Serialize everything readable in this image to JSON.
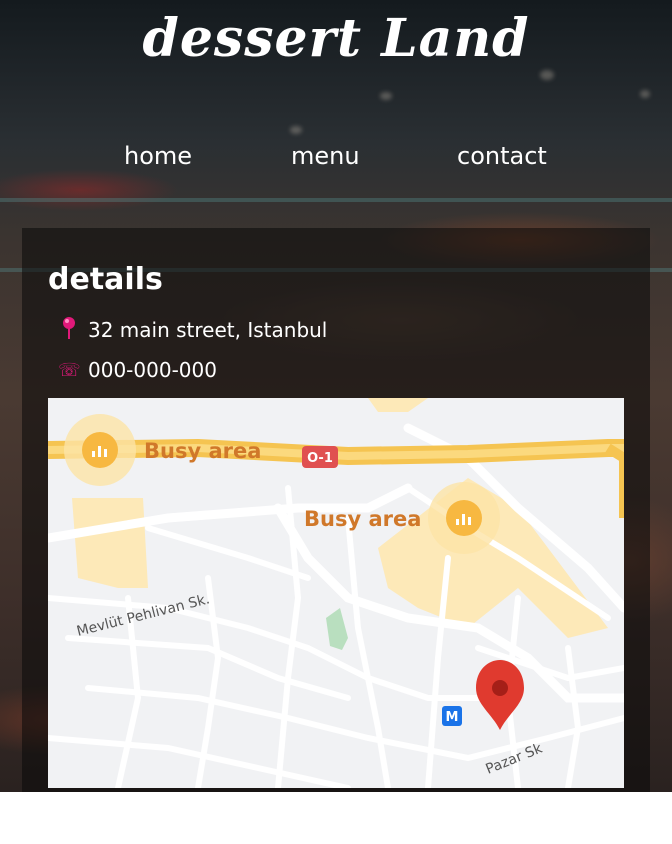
{
  "site": {
    "logo": "dessert Land"
  },
  "nav": {
    "items": [
      "home",
      "menu",
      "contact"
    ]
  },
  "details": {
    "heading": "details",
    "address": "32 main street, Istanbul",
    "phone": "000-000-000"
  },
  "map": {
    "busy_area_label": "Busy area",
    "road_badge": "O-1",
    "streets": [
      "Mevlüt Pehlivan Sk.",
      "Pazar Sk"
    ],
    "metro_label": "M",
    "colors": {
      "busy_text": "#d0782a",
      "road": "#f5c451",
      "pin": "#e03a2f",
      "metro": "#1a73e8"
    }
  },
  "colors": {
    "accent_icon": "#e0197a",
    "text": "#ffffff",
    "panel_bg": "rgba(10,10,10,0.55)"
  }
}
